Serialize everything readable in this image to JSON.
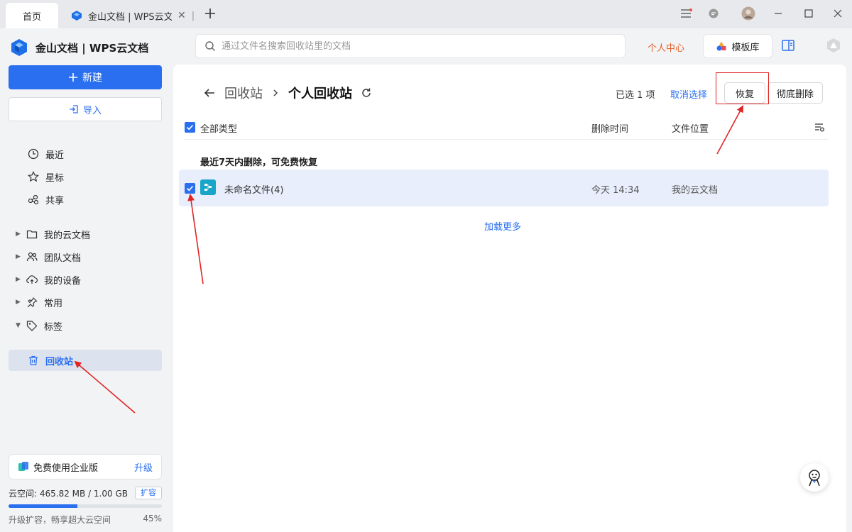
{
  "tabs": {
    "home": "首页",
    "doc": "金山文档 | WPS云文档"
  },
  "app": {
    "name": "金山文档 | WPS云文档",
    "new_label": "新建",
    "import_label": "导入"
  },
  "nav": {
    "recent": "最近",
    "starred": "星标",
    "shared": "共享",
    "my_cloud": "我的云文档",
    "team": "团队文档",
    "devices": "我的设备",
    "common": "常用",
    "tags": "标签",
    "recycle": "回收站"
  },
  "upgrade": {
    "label": "免费使用企业版",
    "action": "升级"
  },
  "storage": {
    "text": "云空间: 465.82 MB / 1.00 GB",
    "expand": "扩容",
    "hint": "升级扩容，畅享超大云空间",
    "percent_label": "45%",
    "fraction": 0.45
  },
  "search": {
    "placeholder": "通过文件名搜索回收站里的文档"
  },
  "header": {
    "personal_center": "个人中心",
    "template_label": "模板库"
  },
  "breadcrumb": {
    "parent": "回收站",
    "current": "个人回收站"
  },
  "selection": {
    "count_text": "已选 1 项",
    "cancel": "取消选择",
    "restore": "恢复",
    "delete_forever": "彻底删除"
  },
  "table": {
    "col_type": "全部类型",
    "col_deleted": "删除时间",
    "col_location": "文件位置",
    "section_title": "最近7天内删除，可免费恢复",
    "rows": [
      {
        "name": "未命名文件(4)",
        "time": "今天 14:34",
        "location": "我的云文档"
      }
    ],
    "load_more": "加载更多"
  },
  "colors": {
    "accent": "#2a6ff0",
    "highlight_red": "#e02424",
    "orange": "#e6602b"
  }
}
